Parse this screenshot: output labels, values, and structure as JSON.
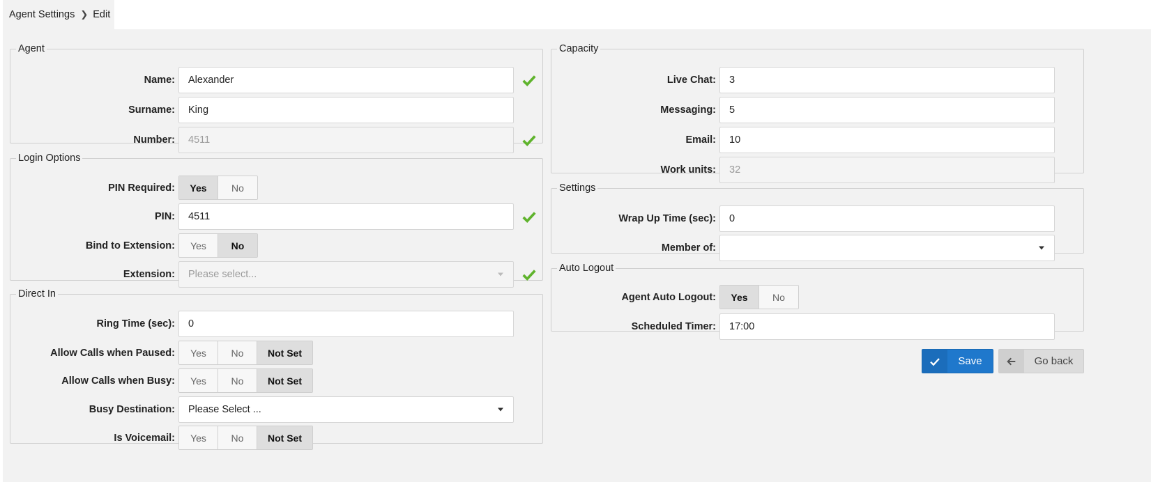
{
  "breadcrumb": {
    "root": "Agent Settings",
    "current": "Edit"
  },
  "agent": {
    "legend": "Agent",
    "name_label": "Name:",
    "name_value": "Alexander",
    "surname_label": "Surname:",
    "surname_value": "King",
    "number_label": "Number:",
    "number_value": "4511"
  },
  "login": {
    "legend": "Login Options",
    "pin_required_label": "PIN Required:",
    "pin_label": "PIN:",
    "pin_value": "4511",
    "bind_label": "Bind to Extension:",
    "extension_label": "Extension:",
    "extension_placeholder": "Please select..."
  },
  "direct": {
    "legend": "Direct In",
    "ring_label": "Ring Time (sec):",
    "ring_value": "0",
    "paused_label": "Allow Calls when Paused:",
    "busy_label": "Allow Calls when Busy:",
    "busy_dest_label": "Busy Destination:",
    "busy_dest_value": "Please Select ...",
    "voicemail_label": "Is Voicemail:"
  },
  "capacity": {
    "legend": "Capacity",
    "live_chat_label": "Live Chat:",
    "live_chat_value": "3",
    "messaging_label": "Messaging:",
    "messaging_value": "5",
    "email_label": "Email:",
    "email_value": "10",
    "work_units_label": "Work units:",
    "work_units_value": "32"
  },
  "settings": {
    "legend": "Settings",
    "wrap_label": "Wrap Up Time (sec):",
    "wrap_value": "0",
    "member_label": "Member of:",
    "member_value": ""
  },
  "autologout": {
    "legend": "Auto Logout",
    "agent_label": "Agent Auto Logout:",
    "timer_label": "Scheduled Timer:",
    "timer_value": "17:00"
  },
  "options": {
    "yes": "Yes",
    "no": "No",
    "not_set": "Not Set"
  },
  "buttons": {
    "save": "Save",
    "back": "Go back"
  },
  "colors": {
    "accent": "#1f78cc",
    "check": "#5fb32c"
  }
}
